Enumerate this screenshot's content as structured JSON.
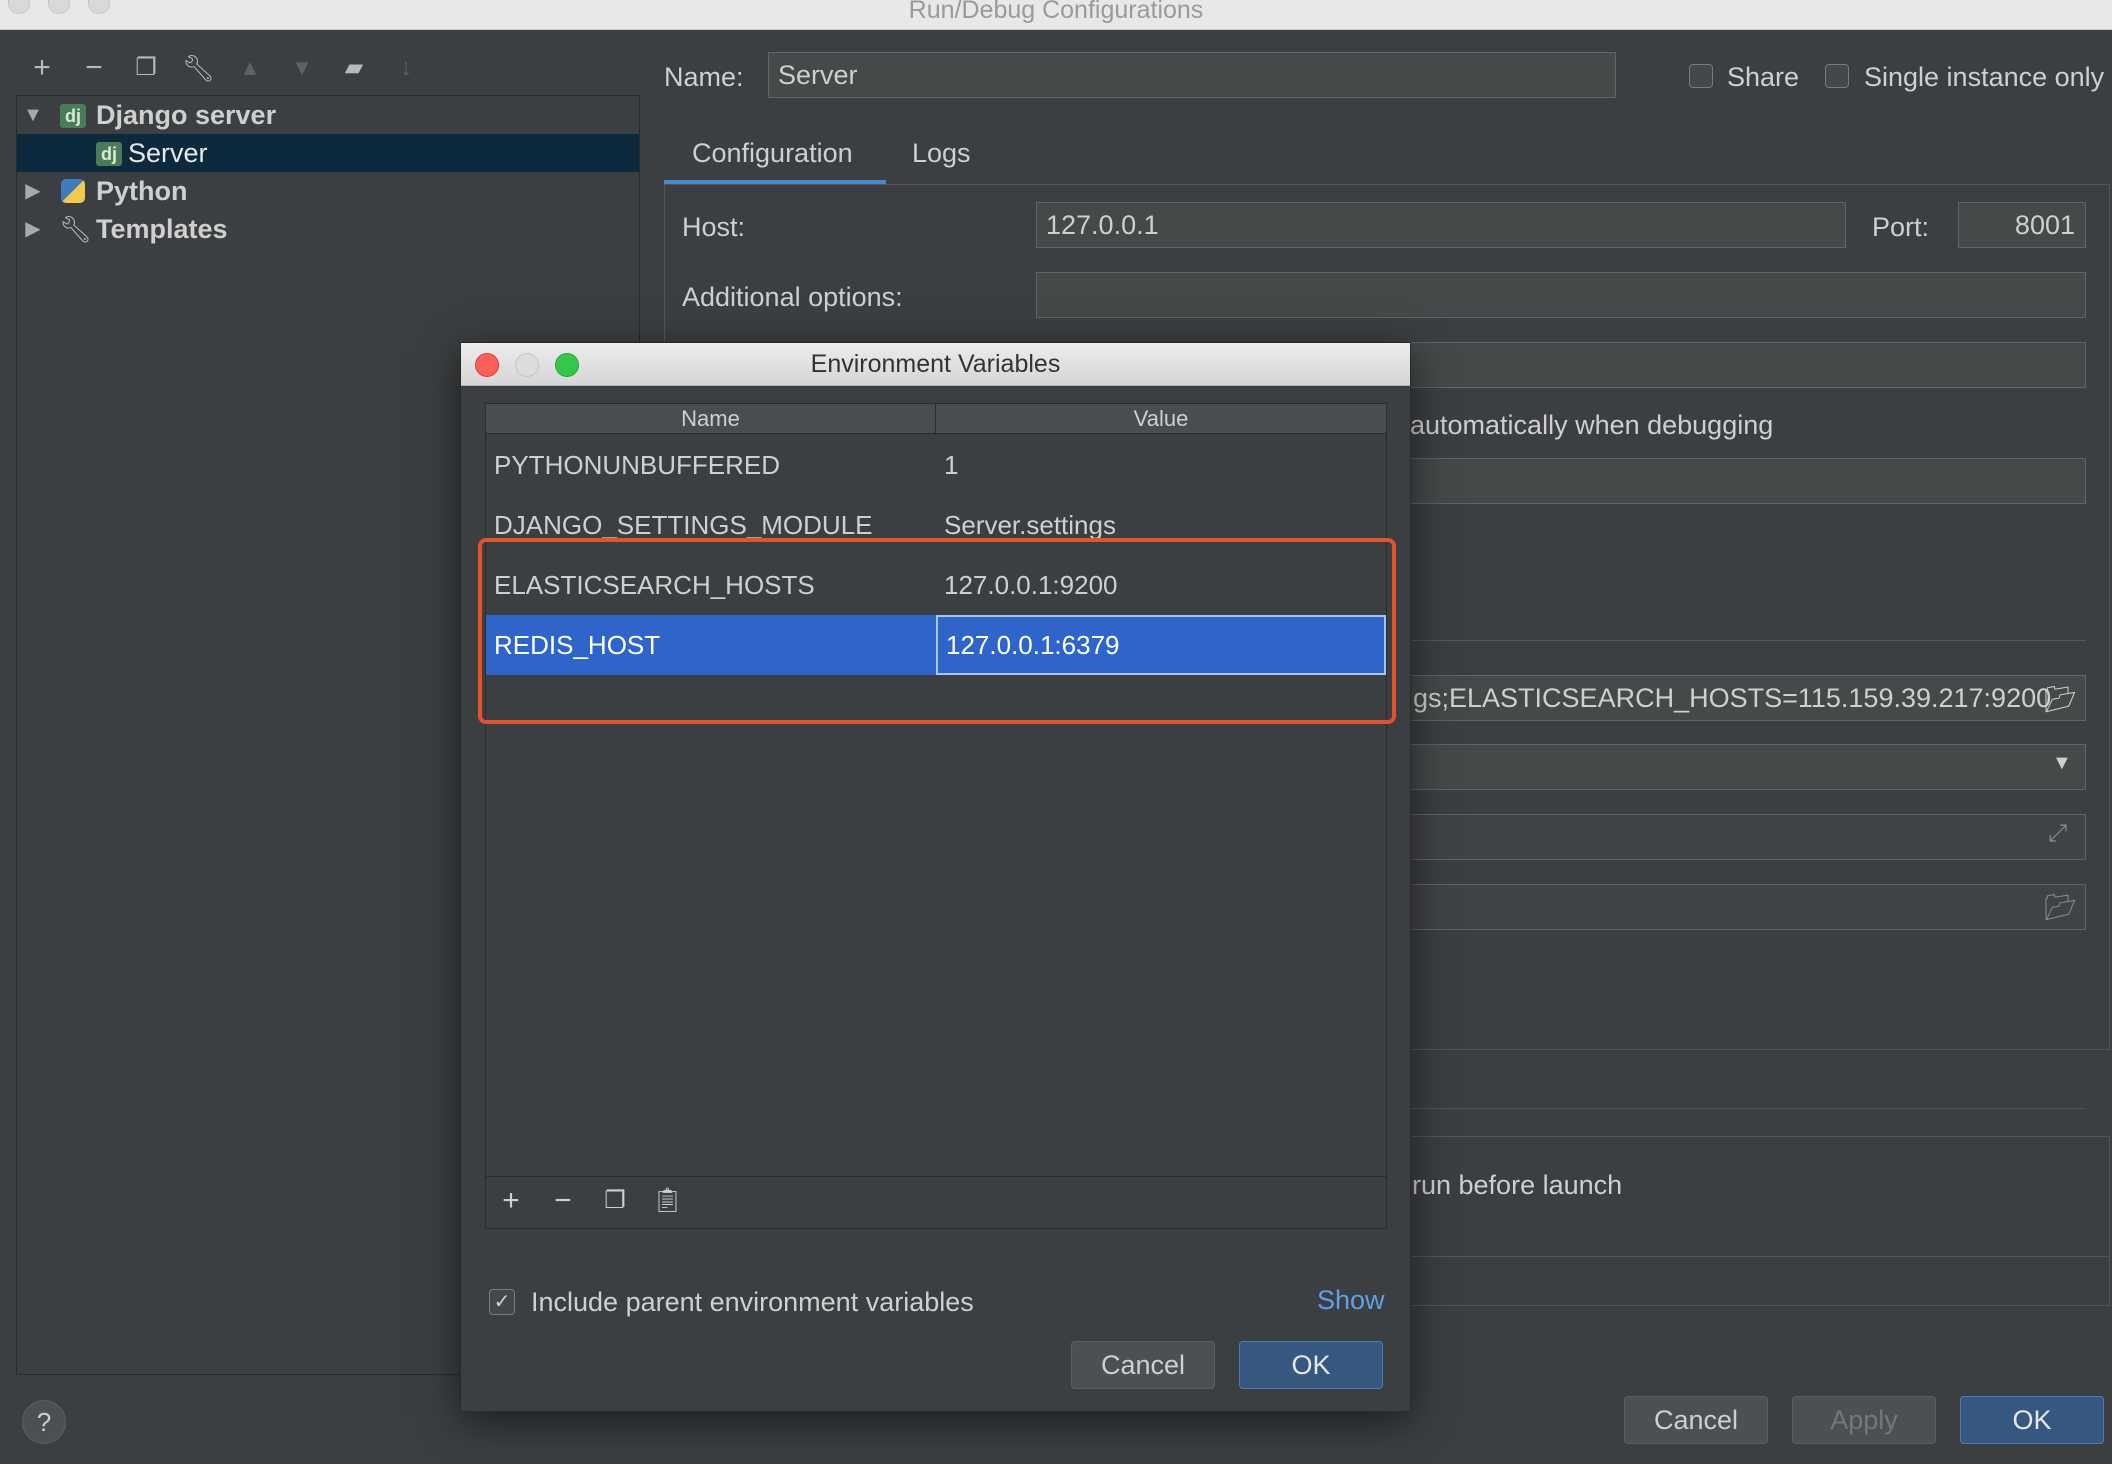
{
  "window": {
    "title": "Run/Debug Configurations"
  },
  "toolbar": {
    "icons": [
      "add-icon",
      "remove-icon",
      "copy-icon",
      "wrench-icon",
      "move-up-icon",
      "move-down-icon",
      "new-folder-icon",
      "sort-icon"
    ]
  },
  "tree": {
    "group": "Django server",
    "child": "Server",
    "python": "Python",
    "templates": "Templates",
    "dj_badge": "dj"
  },
  "form": {
    "name_label": "Name:",
    "name_value": "Server",
    "share_label": "Share",
    "single_instance_label": "Single instance only",
    "tabs": [
      "Configuration",
      "Logs"
    ],
    "host_label": "Host:",
    "host_value": "127.0.0.1",
    "port_label": "Port:",
    "port_value": "8001",
    "additional_options_label": "Additional options:",
    "debug_text_partial": "automatically when debugging",
    "env_value_partial": "gs;ELASTICSEARCH_HOSTS=115.159.39.217:9200",
    "before_launch_partial": "run before launch"
  },
  "buttons": {
    "cancel": "Cancel",
    "apply": "Apply",
    "ok": "OK",
    "help": "?"
  },
  "dialog": {
    "title": "Environment Variables",
    "columns": [
      "Name",
      "Value"
    ],
    "rows": [
      {
        "name": "PYTHONUNBUFFERED",
        "value": "1"
      },
      {
        "name": "DJANGO_SETTINGS_MODULE",
        "value": "Server.settings"
      },
      {
        "name": "ELASTICSEARCH_HOSTS",
        "value": "127.0.0.1:9200"
      },
      {
        "name": "REDIS_HOST",
        "value": "127.0.0.1:6379"
      }
    ],
    "include_parent_label": "Include parent environment variables",
    "include_parent_checked": true,
    "show_link": "Show",
    "cancel": "Cancel",
    "ok": "OK"
  },
  "colors": {
    "accent": "#4a88c7",
    "selection": "#2f65ca",
    "highlight_box": "#e2522b"
  }
}
